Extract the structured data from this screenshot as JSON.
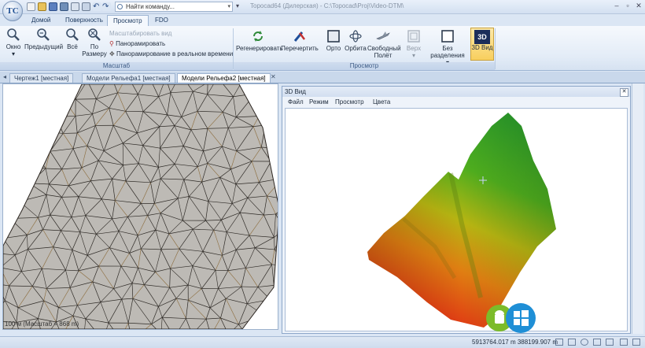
{
  "window": {
    "title": "Topocad64 (Дилерская) - C:\\Topocad\\Proj\\Video-DTM\\",
    "logo_text": "TC"
  },
  "search": {
    "placeholder": "Найти команду..."
  },
  "ribbon_tabs": [
    "Домой",
    "Поверхность",
    "Просмотр",
    "FDO"
  ],
  "active_tab": "Просмотр",
  "ribbon": {
    "scale_group": {
      "caption": "Масштаб",
      "buttons": [
        {
          "label": "Окно",
          "icon": "zoom-window-icon"
        },
        {
          "label": "Предыдущий",
          "icon": "zoom-previous-icon"
        },
        {
          "label": "Всё",
          "icon": "zoom-all-icon"
        },
        {
          "label": "По Размеру",
          "icon": "zoom-extents-icon"
        }
      ],
      "small": [
        "Масштабировать вид",
        "Панорамировать",
        "Панорамирование в реальном времени"
      ]
    },
    "view_group": {
      "caption": "Просмотр",
      "buttons": [
        {
          "label": "Регенерировать",
          "icon": "regenerate-icon"
        },
        {
          "label": "Перечертить",
          "icon": "redraw-icon"
        },
        {
          "label": "Орто",
          "icon": "ortho-icon"
        },
        {
          "label": "Орбита",
          "icon": "orbit-icon"
        },
        {
          "label": "Свободный Полёт",
          "icon": "free-flight-icon"
        },
        {
          "label": "Верх",
          "icon": "top-view-icon"
        },
        {
          "label": "Без разделения",
          "icon": "no-split-icon"
        },
        {
          "label": "3D Вид",
          "icon": "3d-view-icon",
          "badge": "3D"
        }
      ]
    }
  },
  "doc_tabs": [
    "Чертеж1 [местная]",
    "Модели Рельефа1 [местная]",
    "Модели Рельефа2 [местная]"
  ],
  "active_doc_tab": "Модели Рельефа2 [местная]",
  "scale_label": "100 м (Масштаб = 868 m)",
  "view3d": {
    "title": "3D Вид",
    "menu": [
      "Файл",
      "Режим",
      "Просмотр",
      "Цвета"
    ]
  },
  "status": {
    "coords": "5913764.017 m 388199.907 m"
  },
  "colors": {
    "tin_fill": "#bdbab5",
    "tin_line": "#2e2a26",
    "accent": "#1f8fd6"
  }
}
